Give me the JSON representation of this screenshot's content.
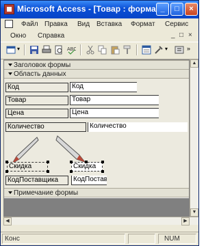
{
  "window": {
    "title": "Microsoft Access - [Товар : форма]",
    "controls": {
      "minimize": "_",
      "maximize": "□",
      "close": "×"
    }
  },
  "menubar": {
    "items": [
      "Файл",
      "Правка",
      "Вид",
      "Вставка",
      "Формат",
      "Сервис"
    ]
  },
  "menubar2": {
    "items": [
      "Окно",
      "Справка"
    ],
    "mdi_controls": [
      "_",
      "□",
      "×"
    ]
  },
  "toolbar": {
    "icons": [
      "form-view-icon",
      "save-icon",
      "print-icon",
      "print-preview-icon",
      "spelling-icon",
      "cut-icon",
      "copy-icon",
      "paste-icon",
      "format-painter-icon",
      "properties-icon",
      "build-icon",
      "toolbox-icon"
    ]
  },
  "form": {
    "header_section": "Заголовок формы",
    "detail_section": "Область данных",
    "footer_section": "Примечание формы",
    "rows": [
      {
        "label": "Код",
        "field": "Код"
      },
      {
        "label": "Товар",
        "field": "Товар"
      },
      {
        "label": "Цена",
        "field": "Цена"
      },
      {
        "label": "Количество",
        "field": "Количество"
      },
      {
        "label": "Скидка",
        "field": "Скидка"
      },
      {
        "label": "КодПоставщика",
        "field": "КодПостав"
      }
    ]
  },
  "statusbar": {
    "mode": "Конс",
    "num": "NUM"
  }
}
